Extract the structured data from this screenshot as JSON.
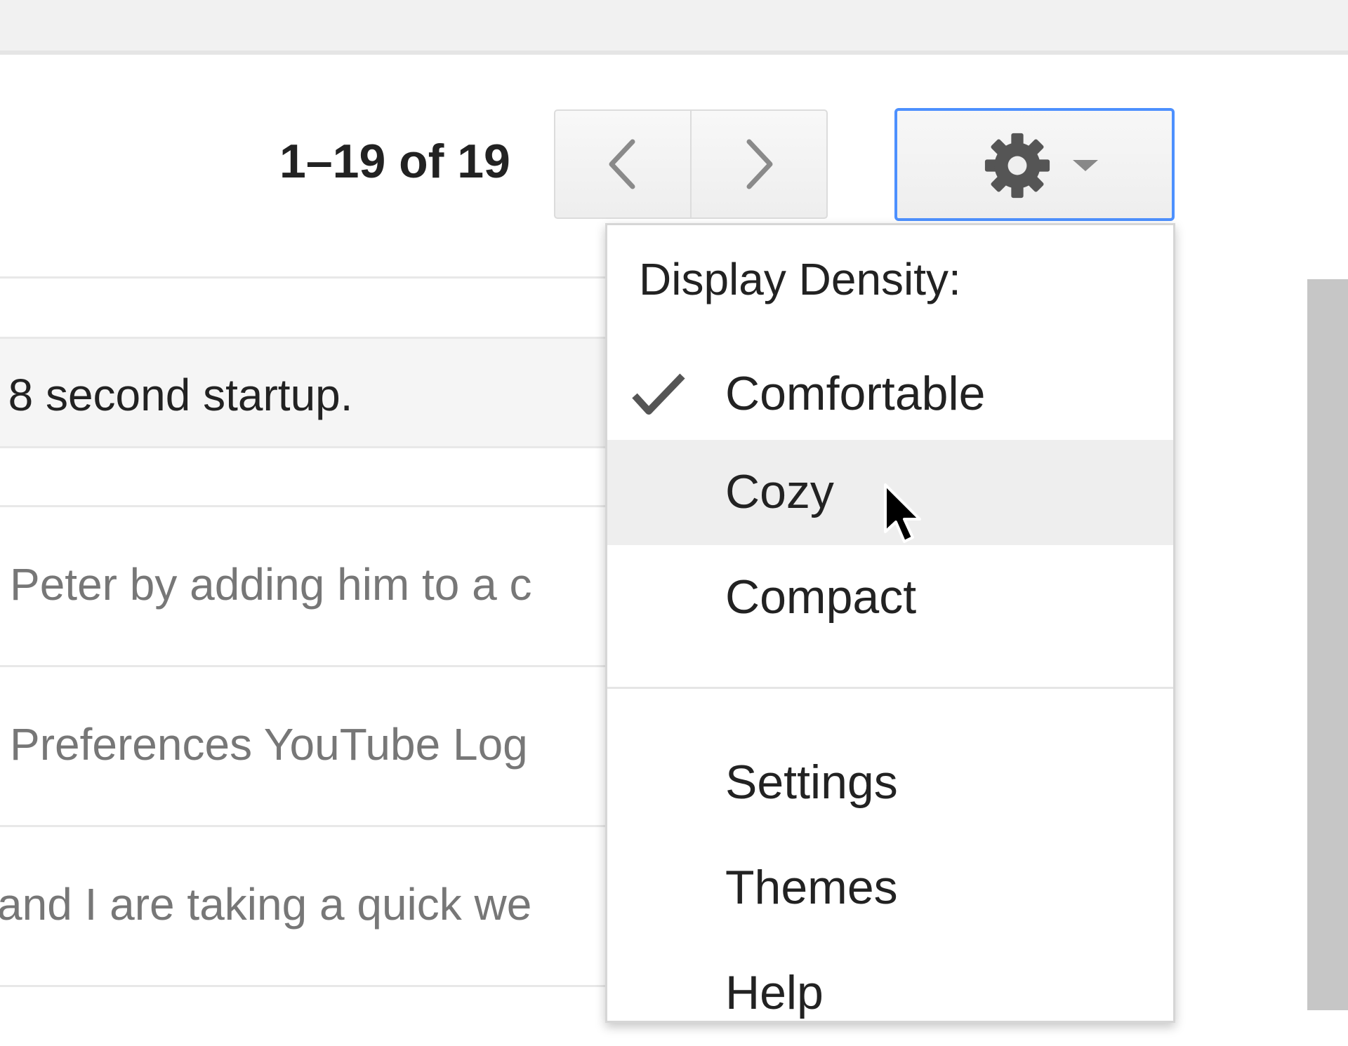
{
  "toolbar": {
    "page_count": "1–19 of 19",
    "older_icon": "chevron-left-icon",
    "newer_icon": "chevron-right-icon",
    "settings_icon": "gear-icon",
    "settings_caret_icon": "caret-down-icon"
  },
  "messages": [
    {
      "snippet": ": 8 second startup.",
      "unread": true
    },
    {
      "snippet": "Peter by adding him to a c",
      "unread": false
    },
    {
      "snippet": "Preferences YouTube Log",
      "unread": false
    },
    {
      "snippet": "and I are taking a quick we",
      "unread": false
    }
  ],
  "menu": {
    "heading": "Display Density:",
    "density_options": [
      {
        "label": "Comfortable",
        "checked": true
      },
      {
        "label": "Cozy",
        "checked": false,
        "hovered": true
      },
      {
        "label": "Compact",
        "checked": false
      }
    ],
    "items": [
      {
        "label": "Settings"
      },
      {
        "label": "Themes"
      },
      {
        "label": "Help"
      }
    ],
    "check_icon": "checkmark-icon"
  },
  "colors": {
    "focus_border": "#4d90fe",
    "hover_bg": "#eeeeee",
    "unread_row_bg": "#f5f5f5"
  }
}
